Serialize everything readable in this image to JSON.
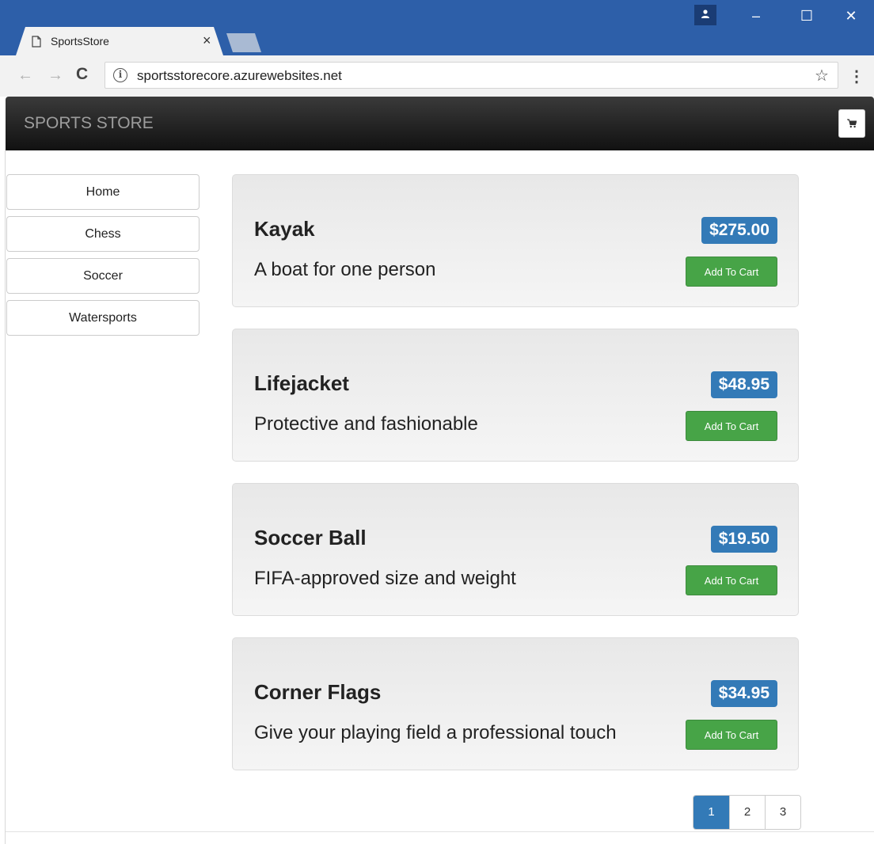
{
  "window": {
    "tab_title": "SportsStore",
    "tab_close": "×",
    "min_glyph": "–",
    "max_glyph": "☐",
    "close_glyph": "✕",
    "icons": [
      "page-icon",
      "profile-icon",
      "minimize-icon",
      "maximize-icon",
      "close-icon"
    ]
  },
  "address_bar": {
    "back_glyph": "←",
    "forward_glyph": "→",
    "reload_glyph": "C",
    "info_glyph": "i",
    "url": "sportsstorecore.azurewebsites.net",
    "star_glyph": "☆",
    "menu_glyph": "⋮"
  },
  "navbar": {
    "brand": "SPORTS STORE",
    "cart_icon": "shopping-cart-icon"
  },
  "categories": [
    {
      "label": "Home"
    },
    {
      "label": "Chess"
    },
    {
      "label": "Soccer"
    },
    {
      "label": "Watersports"
    }
  ],
  "products": [
    {
      "name": "Kayak",
      "description": "A boat for one person",
      "price": "$275.00",
      "button": "Add To Cart"
    },
    {
      "name": "Lifejacket",
      "description": "Protective and fashionable",
      "price": "$48.95",
      "button": "Add To Cart"
    },
    {
      "name": "Soccer Ball",
      "description": "FIFA-approved size and weight",
      "price": "$19.50",
      "button": "Add To Cart"
    },
    {
      "name": "Corner Flags",
      "description": "Give your playing field a professional touch",
      "price": "$34.95",
      "button": "Add To Cart"
    }
  ],
  "pagination": {
    "pages": [
      "1",
      "2",
      "3"
    ],
    "current": "1"
  },
  "colors": {
    "titlebar": "#2d5fa9",
    "price_badge": "#337ab7",
    "add_button": "#47a447",
    "navbar": "#222222"
  }
}
